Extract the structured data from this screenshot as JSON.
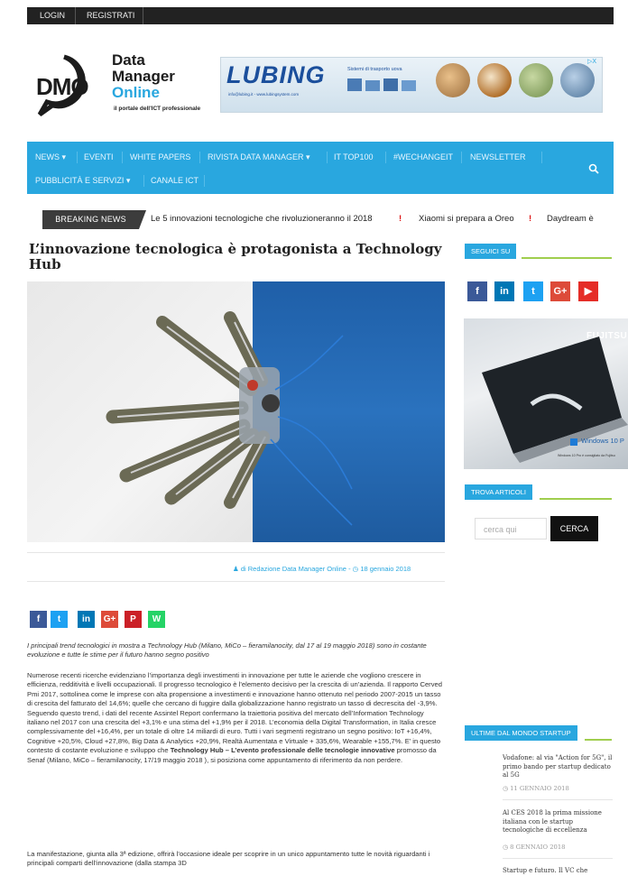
{
  "topbar": {
    "login": "LOGIN",
    "register": "REGISTRATI"
  },
  "header": {
    "logo_letters": "DMO",
    "logo_line1": "Data",
    "logo_line2": "Manager",
    "logo_line3": "Online",
    "logo_tagline": "il portale dell'ICT professionale",
    "banner_brand": "LUBING",
    "banner_tagline": "Sistemi di trasporto uova",
    "banner_contact": "info@lubing.it - www.lubingsystem.com",
    "banner_adchoice": "▷X"
  },
  "nav": {
    "items": [
      {
        "label": "NEWS",
        "caret": "▾"
      },
      {
        "label": "EVENTI"
      },
      {
        "label": "WHITE PAPERS"
      },
      {
        "label": "RIVISTA DATA MANAGER",
        "caret": "▾"
      },
      {
        "label": "IT TOP100"
      },
      {
        "label": "#WECHANGEIT"
      },
      {
        "label": "NEWSLETTER"
      },
      {
        "label": "PUBBLICITÀ E SERVIZI",
        "caret": "▾"
      },
      {
        "label": "CANALE ICT"
      }
    ],
    "search_icon": "search-icon"
  },
  "breaking": {
    "label": "BREAKING NEWS",
    "items": [
      "Le 5 innovazioni tecnologiche che rivoluzioneranno il 2018",
      "Xiaomi si prepara a Oreo",
      "Daydream è"
    ],
    "separator": "!"
  },
  "article": {
    "title": "L’innovazione tecnologica è protagonista a Technology Hub",
    "byline_author": "di Redazione Data Manager Online",
    "byline_date": "18 gennaio 2018",
    "lead": "I principali trend tecnologici in mostra a Technology Hub (Milano, MiCo – fieramilanocity, dal 17 al 19 maggio 2018) sono in costante evoluzione e tutte le stime per il futuro hanno segno positivo",
    "p1_before": "Numerose recenti ricerche evidenziano l’importanza degli investimenti in innovazione per tutte le aziende che vogliono crescere in efficienza, redditività e livelli occupazionali. Il progresso tecnologico è l’elemento decisivo per la crescita di un’azienda. Il rapporto Cerved Pmi 2017, sottolinea come le imprese con alta propensione a investimenti e innovazione hanno ottenuto nel periodo 2007-2015 un tasso di crescita del fatturato del 14,6%; quelle che cercano di fuggire dalla globalizzazione hanno registrato un tasso di decrescita del -3,9%. Seguendo questo trend, i dati del recente Assintel Report confermano la traiettoria positiva del mercato dell’Information Technology italiano nel 2017 con una crescita del +3,1% e una stima del +1,9% per il 2018. L’economia della Digital Transformation, in Italia cresce complessivamente del +16,4%, per un totale di oltre 14 miliardi di euro. Tutti i vari segmenti registrano un segno positivo: IoT +16,4%, Cognitive +20,5%, Cloud +27,8%, Big Data & Analytics +20,9%, Realtà Aumentata e Virtuale + 335,6%, Wearable +155,7%. E’ in questo contesto di costante evoluzione e sviluppo che ",
    "p1_bold": "Technology Hub – L’evento professionale delle tecnologie innovative",
    "p1_after": " promosso da Senaf (Milano, MiCo – fieramilanocity, 17/19 maggio 2018 ), si posiziona come appuntamento di riferimento da non perdere.",
    "p2": "La manifestazione, giunta alla 3ª edizione, offrirà l’occasione ideale per scoprire in un unico appuntamento tutte le novità riguardanti i principali comparti dell’innovazione (dalla stampa 3D"
  },
  "share": {
    "facebook": "f",
    "twitter": "t",
    "linkedin": "in",
    "googleplus": "G+",
    "pinterest": "P",
    "whatsapp": "W"
  },
  "sidebar": {
    "follow_title": "SEGUICI SU",
    "social": {
      "facebook": "f",
      "linkedin": "in",
      "twitter": "t",
      "googleplus": "G+",
      "youtube": "▶"
    },
    "ad_brand": "FUJITSU",
    "ad_windows": "Windows 10 P",
    "ad_small": "Windows 10 Pro è consigliato da Fujitsu",
    "search_title": "TROVA ARTICOLI",
    "search_placeholder": "cerca qui",
    "search_button": "CERCA",
    "startup_title": "ULTIME DAL MONDO STARTUP",
    "startup_items": [
      {
        "title": "Vodafone: al via \"Action for 5G\", il primo bando per startup dedicato al 5G",
        "date": "11 GENNAIO 2018"
      },
      {
        "title": "Al CES 2018 la prima missione italiana con le startup tecnologiche di eccellenza",
        "date": "8 GENNAIO 2018"
      },
      {
        "title": "Startup e futuro. Il VC che",
        "date": ""
      }
    ]
  },
  "colors": {
    "accent": "#29a7df",
    "green": "#a0ce4e",
    "dark": "#222222"
  }
}
